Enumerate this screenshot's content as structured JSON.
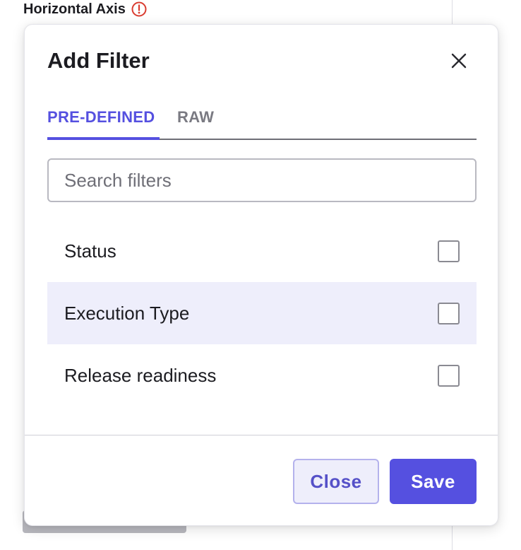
{
  "background": {
    "section_label": "Horizontal Axis",
    "warning_icon": "exclamation-circle-icon",
    "warning_color": "#d93c30"
  },
  "modal": {
    "title": "Add Filter",
    "close_icon": "close-icon",
    "tabs": [
      {
        "label": "PRE-DEFINED",
        "active": true
      },
      {
        "label": "RAW",
        "active": false
      }
    ],
    "search": {
      "placeholder": "Search filters",
      "value": ""
    },
    "filters": [
      {
        "label": "Status",
        "checked": false,
        "hovered": false
      },
      {
        "label": "Execution Type",
        "checked": false,
        "hovered": true
      },
      {
        "label": "Release readiness",
        "checked": false,
        "hovered": false
      }
    ],
    "buttons": {
      "close_label": "Close",
      "save_label": "Save"
    }
  },
  "colors": {
    "accent": "#5550e0",
    "hover_row": "#eeeefb",
    "text": "#1c1c21"
  }
}
